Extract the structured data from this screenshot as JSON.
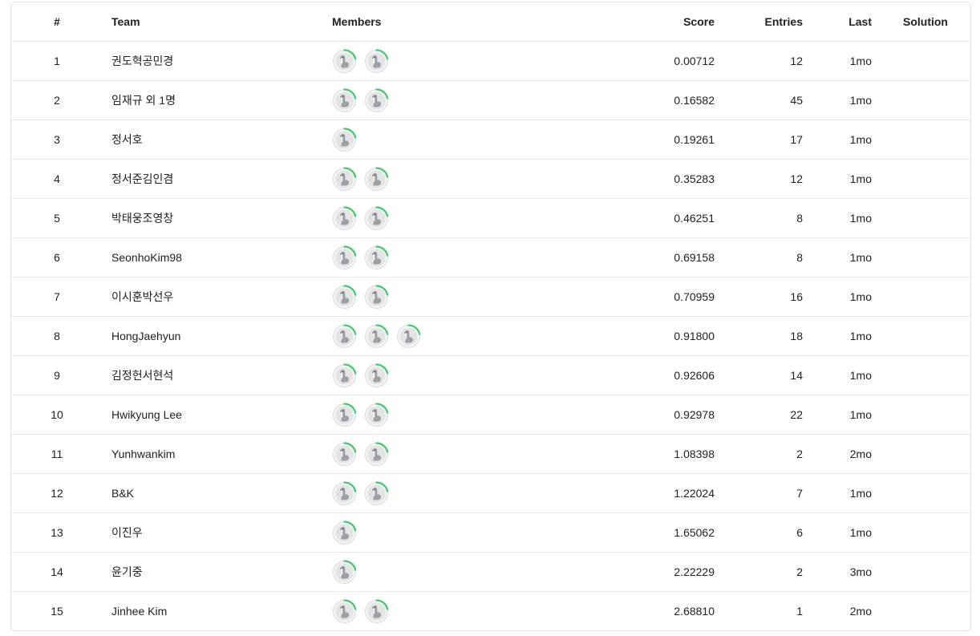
{
  "headers": {
    "rank": "#",
    "team": "Team",
    "members": "Members",
    "score": "Score",
    "entries": "Entries",
    "last": "Last",
    "solution": "Solution"
  },
  "avatar_icon": "default-goose-avatar-icon",
  "progress_ring_color": "#20BEFF",
  "progress_ring_accent": "#3ec96a",
  "rows": [
    {
      "rank": "1",
      "team": "권도혁공민경",
      "members": 2,
      "score": "0.00712",
      "entries": "12",
      "last": "1mo",
      "solution": ""
    },
    {
      "rank": "2",
      "team": "임재규 외 1명",
      "members": 2,
      "score": "0.16582",
      "entries": "45",
      "last": "1mo",
      "solution": ""
    },
    {
      "rank": "3",
      "team": "정서호",
      "members": 1,
      "score": "0.19261",
      "entries": "17",
      "last": "1mo",
      "solution": ""
    },
    {
      "rank": "4",
      "team": "정서준김인겸",
      "members": 2,
      "score": "0.35283",
      "entries": "12",
      "last": "1mo",
      "solution": ""
    },
    {
      "rank": "5",
      "team": "박태웅조영창",
      "members": 2,
      "score": "0.46251",
      "entries": "8",
      "last": "1mo",
      "solution": ""
    },
    {
      "rank": "6",
      "team": "SeonhoKim98",
      "members": 2,
      "score": "0.69158",
      "entries": "8",
      "last": "1mo",
      "solution": ""
    },
    {
      "rank": "7",
      "team": "이시훈박선우",
      "members": 2,
      "score": "0.70959",
      "entries": "16",
      "last": "1mo",
      "solution": ""
    },
    {
      "rank": "8",
      "team": "HongJaehyun",
      "members": 3,
      "score": "0.91800",
      "entries": "18",
      "last": "1mo",
      "solution": ""
    },
    {
      "rank": "9",
      "team": "김정헌서현석",
      "members": 2,
      "score": "0.92606",
      "entries": "14",
      "last": "1mo",
      "solution": ""
    },
    {
      "rank": "10",
      "team": "Hwikyung Lee",
      "members": 2,
      "score": "0.92978",
      "entries": "22",
      "last": "1mo",
      "solution": ""
    },
    {
      "rank": "11",
      "team": "Yunhwankim",
      "members": 2,
      "score": "1.08398",
      "entries": "2",
      "last": "2mo",
      "solution": ""
    },
    {
      "rank": "12",
      "team": "B&K",
      "members": 2,
      "score": "1.22024",
      "entries": "7",
      "last": "1mo",
      "solution": ""
    },
    {
      "rank": "13",
      "team": "이진우",
      "members": 1,
      "score": "1.65062",
      "entries": "6",
      "last": "1mo",
      "solution": ""
    },
    {
      "rank": "14",
      "team": "윤기중",
      "members": 1,
      "score": "2.22229",
      "entries": "2",
      "last": "3mo",
      "solution": ""
    },
    {
      "rank": "15",
      "team": "Jinhee Kim",
      "members": 2,
      "score": "2.68810",
      "entries": "1",
      "last": "2mo",
      "solution": ""
    }
  ]
}
